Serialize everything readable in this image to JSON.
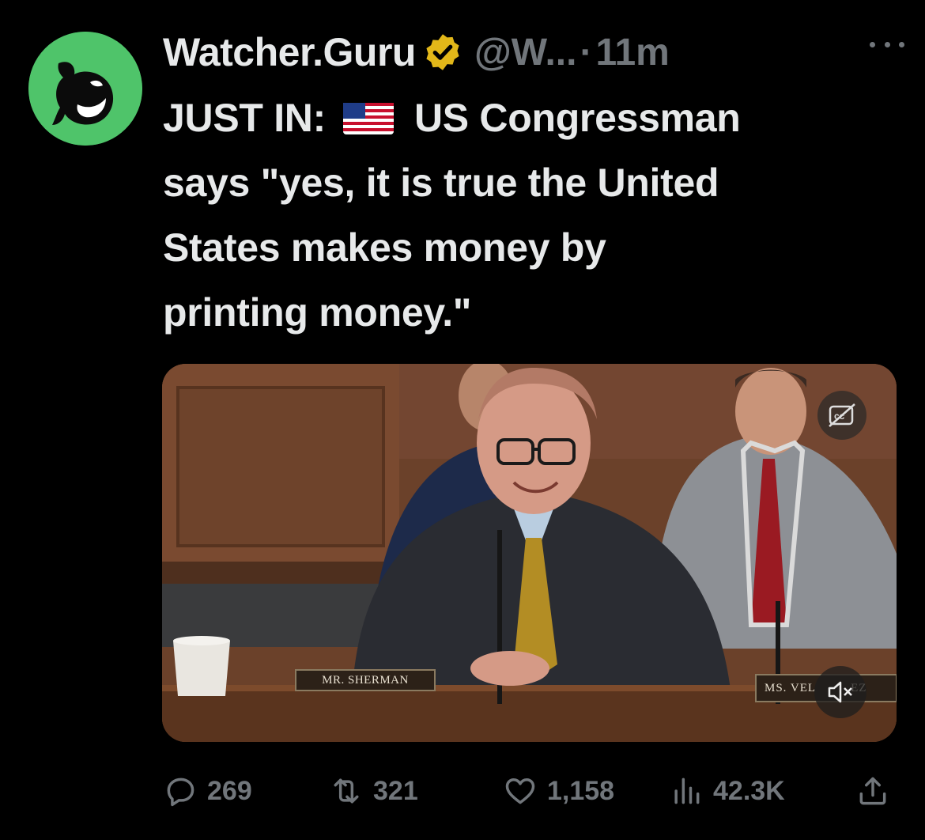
{
  "tweet": {
    "author_name": "Watcher.Guru",
    "handle": "@W...",
    "separator": "·",
    "time": "11m",
    "text_line1_prefix": "JUST IN:",
    "text_line1_suffix": "US Congressman",
    "text_line2": "says \"yes, it is true the United",
    "text_line3": "States makes money by",
    "text_line4": "printing money.\""
  },
  "media": {
    "nameplate_left": "MR. SHERMAN",
    "nameplate_right": "MS. VEL",
    "nameplate_right_end": "EZ"
  },
  "actions": {
    "replies": "269",
    "reposts": "321",
    "likes": "1,158",
    "views": "42.3K"
  },
  "colors": {
    "background": "#000000",
    "text": "#e7e9ea",
    "muted": "#71767b",
    "avatar_bg": "#4fc46a",
    "verified_gold": "#e2b719"
  },
  "icons": [
    "avatar-logo",
    "verified-badge-icon",
    "more-icon",
    "us-flag-icon",
    "cc-icon",
    "mute-icon",
    "reply-icon",
    "repost-icon",
    "like-icon",
    "views-icon",
    "share-icon"
  ]
}
